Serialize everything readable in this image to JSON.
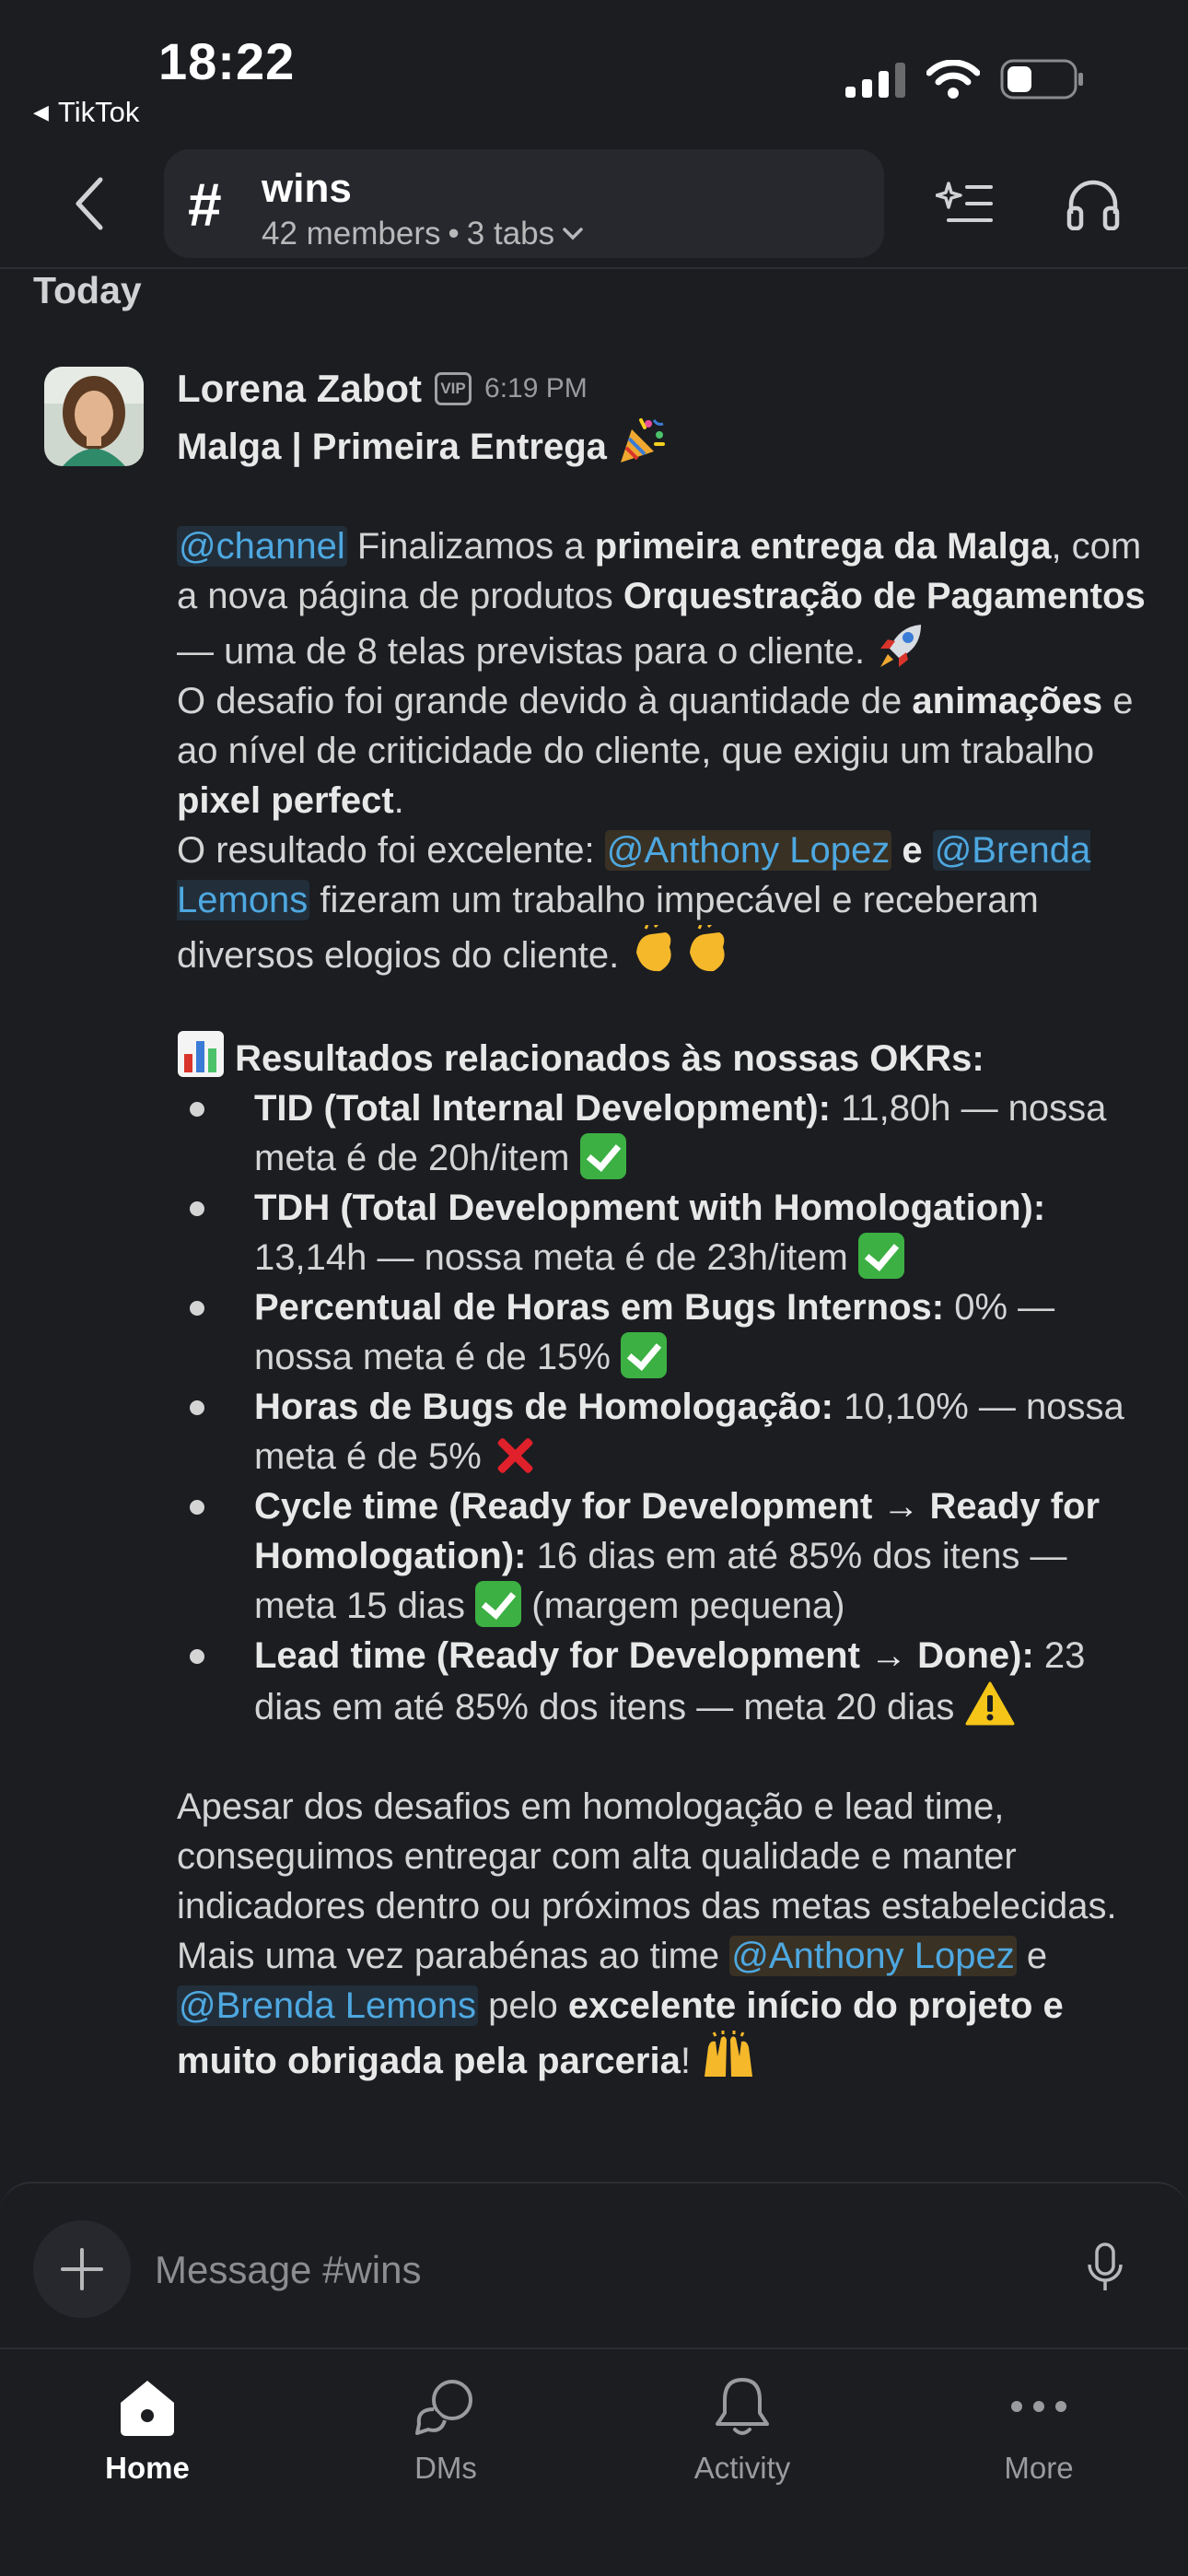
{
  "status_bar": {
    "time": "18:22",
    "back_app": "TikTok"
  },
  "header": {
    "channel_name": "wins",
    "members": "42 members",
    "separator": "•",
    "tabs": "3 tabs"
  },
  "feed": {
    "day_label": "Today"
  },
  "message": {
    "author": "Lorena Zabot",
    "badge": "VIP",
    "time": "6:19 PM",
    "title": "Malga | Primeira Entrega",
    "p1_mention": "@channel",
    "p1_a": " Finalizamos a ",
    "p1_b": "primeira entrega da Malga",
    "p1_c": ", com a nova página de produtos ",
    "p1_d": "Orquestração de Pagamentos",
    "p1_e": " — uma de 8 telas previstas para o cliente.",
    "p2_a": "O desafio foi grande devido à quantidade de ",
    "p2_b": "animações",
    "p2_c": " e ao nível de criticidade do cliente, que exigiu um trabalho ",
    "p2_d": "pixel perfect",
    "p2_e": ".",
    "p3_a": " O resultado foi excelente: ",
    "p3_mention1": "@Anthony Lopez",
    "p3_b": " e ",
    "p3_mention2": "@Brenda Lemons",
    "p3_c": " fizeram um trabalho impecável e receberam diversos elogios do cliente.",
    "okr_heading": "Resultados relacionados às nossas OKRs:",
    "okrs": [
      {
        "label": "TID (Total Internal Development):",
        "text": " 11,80h — nossa meta é de 20h/item",
        "tail": ""
      },
      {
        "label": "TDH (Total Development with Homologation):",
        "text": " 13,14h — nossa meta é de 23h/item",
        "tail": ""
      },
      {
        "label": "Percentual de Horas em Bugs Internos:",
        "text": " 0% — nossa meta é de 15%",
        "tail": ""
      },
      {
        "label": "Horas de Bugs de Homologação:",
        "text": " 10,10% — nossa meta é de 5%",
        "tail": ""
      },
      {
        "label": "Cycle time (Ready for Development → Ready for Homologation):",
        "text": " 16 dias em até 85% dos itens — meta 15 dias",
        "tail": " (margem pequena)"
      },
      {
        "label": "Lead time (Ready for Development → Done):",
        "text": " 23 dias em até 85% dos itens — meta 20 dias",
        "tail": ""
      }
    ],
    "p4": "Apesar dos desafios em homologação e lead time, conseguimos entregar com alta qualidade e manter indicadores dentro ou próximos das metas estabelecidas.",
    "p5_a": "Mais uma vez parabénas ao time ",
    "p5_mention1": "@Anthony Lopez",
    "p5_b": " e ",
    "p5_mention2": "@Brenda Lemons",
    "p5_c": " pelo ",
    "p5_d": "excelente início do projeto e muito obrigada pela parceria",
    "p5_e": "!"
  },
  "composer": {
    "placeholder": "Message #wins"
  },
  "tabs": [
    {
      "label": "Home",
      "icon": "home-icon"
    },
    {
      "label": "DMs",
      "icon": "dms-icon"
    },
    {
      "label": "Activity",
      "icon": "bell-icon"
    },
    {
      "label": "More",
      "icon": "more-icon"
    }
  ],
  "colors": {
    "background": "#1b1d21",
    "mention": "#4ea8e0",
    "check": "#3cb043",
    "cross": "#e0202a"
  }
}
